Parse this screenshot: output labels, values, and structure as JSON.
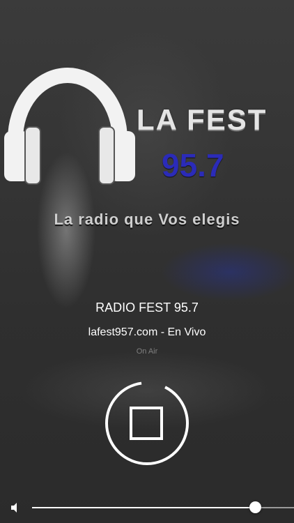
{
  "logo": {
    "brand_line1": "LA FEST",
    "brand_frequency": "95.7",
    "tagline": "La radio que Vos elegis",
    "frequency_color": "#2b2bb8",
    "icon": "headphones-icon"
  },
  "player": {
    "station_name": "RADIO FEST 95.7",
    "subtitle": "lafest957.com - En Vivo",
    "status": "On Air",
    "control_icon": "stop-icon"
  },
  "volume": {
    "icon": "speaker-icon",
    "level": 0.85
  }
}
